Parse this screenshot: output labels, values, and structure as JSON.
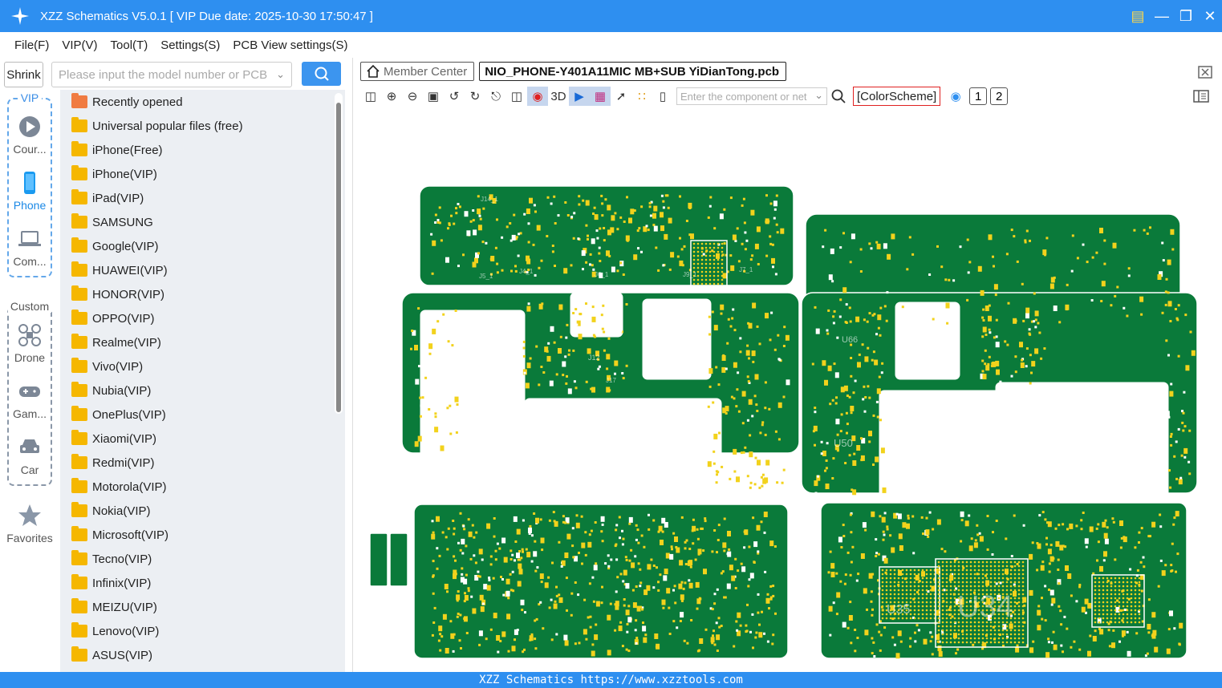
{
  "titlebar": {
    "title": "XZZ Schematics V5.0.1 [ VIP Due date: 2025-10-30 17:50:47 ]"
  },
  "menu": [
    "File(F)",
    "VIP(V)",
    "Tool(T)",
    "Settings(S)",
    "PCB View settings(S)"
  ],
  "search": {
    "shrink_label": "Shrink",
    "placeholder": "Please input the model number or PCB"
  },
  "categories": {
    "vip_group": "VIP",
    "items": [
      {
        "label": "Cour...",
        "icon": "play-circle-icon"
      },
      {
        "label": "Phone",
        "icon": "phone-icon"
      },
      {
        "label": "Com...",
        "icon": "laptop-icon"
      }
    ],
    "custom_group": "Custom",
    "custom_items": [
      {
        "label": "Drone",
        "icon": "drone-icon"
      },
      {
        "label": "Gam...",
        "icon": "gamepad-icon"
      },
      {
        "label": "Car",
        "icon": "car-icon"
      }
    ],
    "favorites": "Favorites"
  },
  "tree": [
    "Recently opened",
    "Universal popular files (free)",
    "iPhone(Free)",
    "iPhone(VIP)",
    "iPad(VIP)",
    "SAMSUNG",
    "Google(VIP)",
    "HUAWEI(VIP)",
    "HONOR(VIP)",
    "OPPO(VIP)",
    "Realme(VIP)",
    "Vivo(VIP)",
    "Nubia(VIP)",
    "OnePlus(VIP)",
    "Xiaomi(VIP)",
    "Redmi(VIP)",
    "Motorola(VIP)",
    "Nokia(VIP)",
    "Microsoft(VIP)",
    "Tecno(VIP)",
    "Infinix(VIP)",
    "MEIZU(VIP)",
    "Lenovo(VIP)",
    "ASUS(VIP)"
  ],
  "tabs": {
    "member": "Member Center",
    "file": "NIO_PHONE-Y401A11MIC MB+SUB YiDianTong.pcb"
  },
  "toolbar": {
    "three_d": "3D",
    "component_placeholder": "Enter the component or net",
    "color_scheme": "[ColorScheme]",
    "page1": "1",
    "page2": "2"
  },
  "pcb": {
    "labels": [
      "U34",
      "U35",
      "U50",
      "U66",
      "J12",
      "J14_1",
      "J5_1",
      "J4_1",
      "J6_1",
      "J9_1",
      "J7_1",
      "J17"
    ],
    "colors": {
      "board": "#0a7a3a",
      "pad": "#f2d21c",
      "outline": "#ffffff"
    }
  },
  "status": {
    "text": "XZZ Schematics https://www.xzztools.com"
  }
}
